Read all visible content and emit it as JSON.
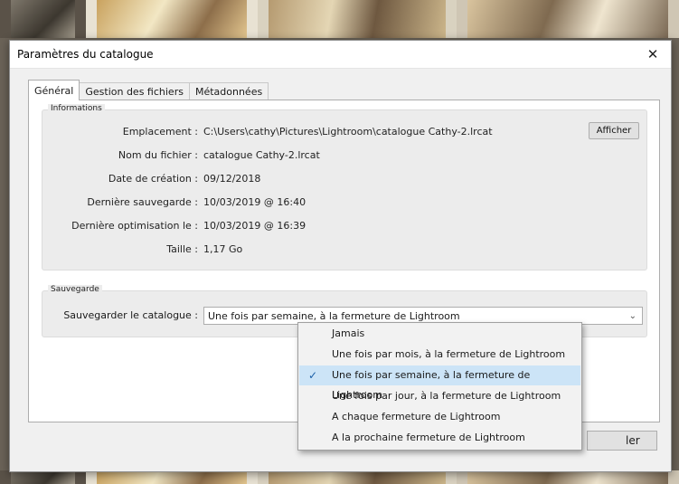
{
  "dialog": {
    "title": "Paramètres du catalogue",
    "close_glyph": "✕",
    "tabs": [
      {
        "label": "Général",
        "active": true
      },
      {
        "label": "Gestion des fichiers",
        "active": false
      },
      {
        "label": "Métadonnées",
        "active": false
      }
    ]
  },
  "info": {
    "legend": "Informations",
    "rows": [
      {
        "label": "Emplacement :",
        "value": "C:\\Users\\cathy\\Pictures\\Lightroom\\catalogue Cathy-2.lrcat"
      },
      {
        "label": "Nom du fichier :",
        "value": "catalogue Cathy-2.lrcat"
      },
      {
        "label": "Date de création :",
        "value": "09/12/2018"
      },
      {
        "label": "Dernière sauvegarde :",
        "value": "10/03/2019 @ 16:40"
      },
      {
        "label": "Dernière optimisation le :",
        "value": "10/03/2019 @ 16:39"
      },
      {
        "label": "Taille :",
        "value": "1,17 Go"
      }
    ],
    "show_button": "Afficher"
  },
  "backup": {
    "legend": "Sauvegarde",
    "label": "Sauvegarder le catalogue :",
    "selected": "Une fois par semaine, à la fermeture de Lightroom",
    "options": [
      "Jamais",
      "Une fois par mois, à la fermeture de Lightroom",
      "Une fois par semaine, à la fermeture de Lightroom",
      "Une fois par jour, à la fermeture de Lightroom",
      "A chaque fermeture de Lightroom",
      "A la prochaine fermeture de Lightroom"
    ],
    "selected_index": 2
  },
  "footer": {
    "cancel_visible_text": "ler"
  },
  "icons": {
    "close": "close-icon",
    "chevron": "chevron-down-icon",
    "check": "checkmark-icon"
  },
  "colors": {
    "selection": "#cce4f7",
    "check": "#1a5fa8",
    "primary_button_border": "#0078d7"
  }
}
